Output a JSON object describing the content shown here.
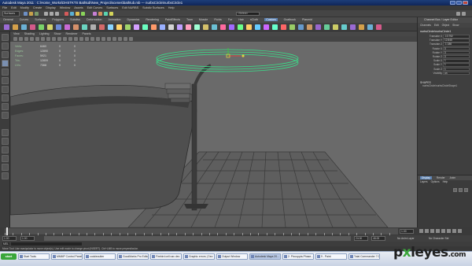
{
  "window": {
    "title": "Autodesk Maya 2011 : C:\\Home_Works\\DHSTKTS Bathtub\\New_Project\\scenes\\bathtub.mb  ---  nurbsCircle\\nurbsCircle1"
  },
  "menubar": {
    "items": [
      "File",
      "Edit",
      "Modify",
      "Create",
      "Display",
      "Window",
      "Assets",
      "Edit Curves",
      "Surfaces",
      "Edit NURBS",
      "Subdiv Surfaces",
      "Help"
    ]
  },
  "status_line": {
    "mode": "Surfaces",
    "field_value": "<Select>"
  },
  "shelf": {
    "tabs": [
      "General",
      "Curves",
      "Surfaces",
      "Polygons",
      "Subdivs",
      "Deformation",
      "Animation",
      "Dynamics",
      "Rendering",
      "PaintEffects",
      "Toon",
      "Muscle",
      "Fluids",
      "Fur",
      "Hair",
      "nCloth",
      "Custom",
      "Goalbook",
      "Plasmid"
    ],
    "active_tab": "Custom"
  },
  "viewport": {
    "panel_menu": [
      "View",
      "Shading",
      "Lighting",
      "Show",
      "Renderer",
      "Panels"
    ],
    "hud": {
      "rows": [
        {
          "label": "Verts:",
          "v1": "6460",
          "v2": "0",
          "v3": "0"
        },
        {
          "label": "Edges:",
          "v1": "12890",
          "v2": "0",
          "v3": "0"
        },
        {
          "label": "Faces:",
          "v1": "5921",
          "v2": "0",
          "v3": "0"
        },
        {
          "label": "Tris:",
          "v1": "12809",
          "v2": "0",
          "v3": "0"
        },
        {
          "label": "UVs:",
          "v1": "7368",
          "v2": "0",
          "v3": "0"
        }
      ]
    }
  },
  "channel_box": {
    "title": "Channel Box / Layer Editor",
    "menu": [
      "Channels",
      "Edit",
      "Object",
      "Show"
    ],
    "object_name": "nurbsCircle\\nurbsCircle1",
    "attributes": [
      {
        "name": "Translate X",
        "value": "-13.752"
      },
      {
        "name": "Translate Y",
        "value": "12.845"
      },
      {
        "name": "Translate Z",
        "value": "-1.186"
      },
      {
        "name": "Rotate X",
        "value": "0"
      },
      {
        "name": "Rotate Y",
        "value": "0"
      },
      {
        "name": "Rotate Z",
        "value": "0"
      },
      {
        "name": "Scale X",
        "value": "1"
      },
      {
        "name": "Scale Y",
        "value": "1"
      },
      {
        "name": "Scale Z",
        "value": "1"
      },
      {
        "name": "Visibility",
        "value": "on"
      }
    ],
    "shapes_header": "SHAPES",
    "shape_name": "nurbsCircle\\nurbsCircleShape1"
  },
  "layer_editor": {
    "tabs": [
      "Display",
      "Render",
      "Anim"
    ],
    "active_tab": "Display",
    "submenu": [
      "Layers",
      "Options",
      "Help"
    ]
  },
  "time_slider": {
    "current_frame": "1.00",
    "tick_labels": [
      "1",
      "2",
      "4",
      "6",
      "8",
      "10",
      "12",
      "14",
      "16",
      "18",
      "20",
      "22",
      "24"
    ]
  },
  "range_slider": {
    "start": "1.00",
    "inner_start": "1.00",
    "inner_end": "24.00",
    "end": "48.00",
    "anim_layer": "No Anim Layer",
    "character_set": "No Character Set"
  },
  "command_line": {
    "label": "MEL"
  },
  "help_line": {
    "text": "Move Tool: Use manipulator to move object(s). Use edit mode to change pivot (INSERT). Ctrl+LMB to move perpendicular."
  },
  "taskbar": {
    "start_label": "start",
    "tasks": [
      {
        "label": "Start Tools",
        "active": false
      },
      {
        "label": "MMMP Control Panel",
        "active": false
      },
      {
        "label": "cookiecutter",
        "active": false
      },
      {
        "label": "GoodMarks Pro Editor",
        "active": false
      },
      {
        "label": "Firebird cell nav dev",
        "active": false
      },
      {
        "label": "Graphic errors | Dev",
        "active": false
      },
      {
        "label": "Output Window",
        "active": false
      },
      {
        "label": "Autodesk Maya 20...",
        "active": true
      },
      {
        "label": "2. Pixcoppia-Phase...",
        "active": false
      },
      {
        "label": "9 - Paint",
        "active": false
      },
      {
        "label": "Total Commander 7.0...",
        "active": false
      }
    ]
  },
  "watermark": {
    "text": "pxleyes",
    "suffix": ".com"
  },
  "colors": {
    "viewport_bg": "#6a6a6a",
    "selection_circle": "#39e08a",
    "active_tab": "#5c82b3",
    "taskbar": "#c9d3e4"
  }
}
